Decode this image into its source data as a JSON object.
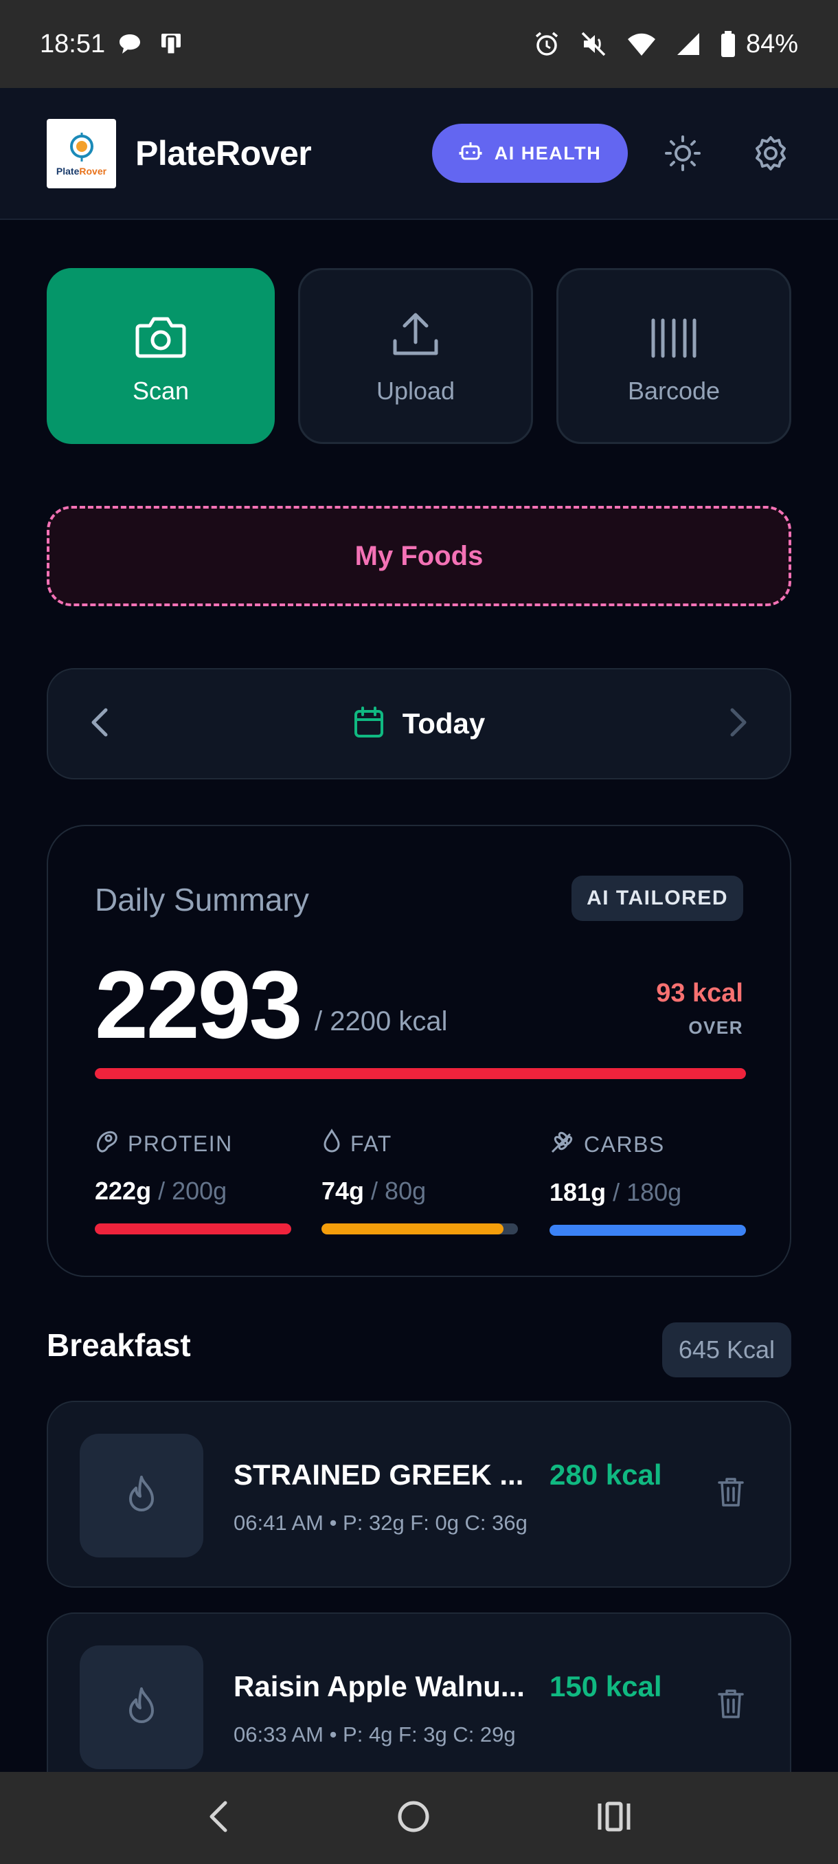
{
  "status_bar": {
    "time": "18:51",
    "battery": "84%"
  },
  "header": {
    "app_name": "PlateRover",
    "logo_text": "PlateRover",
    "ai_health_label": "AI HEALTH"
  },
  "actions": {
    "scan_label": "Scan",
    "upload_label": "Upload",
    "barcode_label": "Barcode"
  },
  "my_foods_label": "My Foods",
  "date_nav": {
    "label": "Today"
  },
  "summary": {
    "title": "Daily Summary",
    "badge": "AI TAILORED",
    "calories": "2293",
    "goal_text": "/ 2200 kcal",
    "over_value": "93 kcal",
    "over_label": "OVER",
    "progress": 1.0,
    "macros": [
      {
        "label": "PROTEIN",
        "current": "222g",
        "goal": " / 200g",
        "progress": 1.0,
        "color": "#ef233c"
      },
      {
        "label": "FAT",
        "current": "74g",
        "goal": " / 80g",
        "progress": 0.925,
        "color": "#f59e0b"
      },
      {
        "label": "CARBS",
        "current": "181g",
        "goal": " / 180g",
        "progress": 1.0,
        "color": "#3b82f6"
      }
    ]
  },
  "meal": {
    "title": "Breakfast",
    "kcal": "645 Kcal",
    "items": [
      {
        "name": "STRAINED GREEK ...",
        "kcal": "280 kcal",
        "meta": "06:41 AM • P: 32g F: 0g C: 36g"
      },
      {
        "name": "Raisin Apple Walnu...",
        "kcal": "150 kcal",
        "meta": "06:33 AM • P: 4g F: 3g C: 29g"
      }
    ]
  },
  "colors": {
    "accent_green": "#059669",
    "accent_indigo": "#6366f1",
    "accent_pink": "#f472b6",
    "over_red": "#f87171"
  }
}
